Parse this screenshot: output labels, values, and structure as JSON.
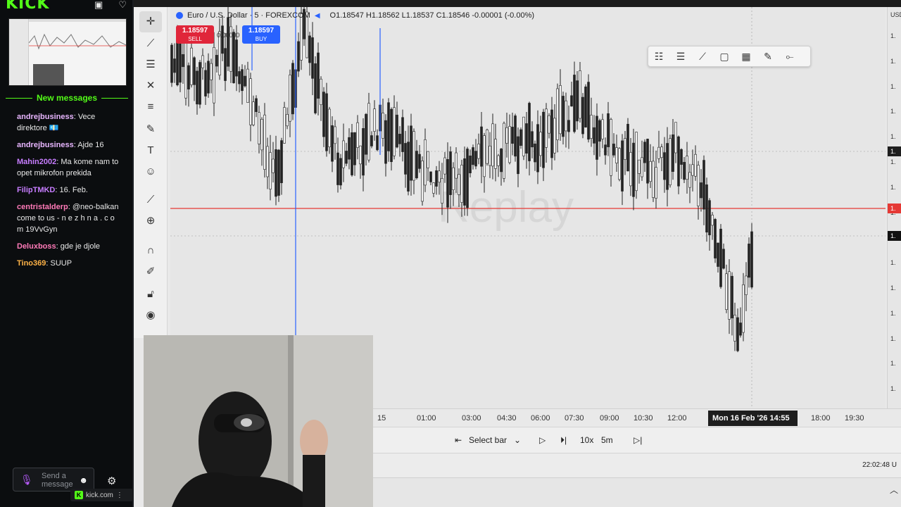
{
  "kick": {
    "logo": "KICK",
    "new_messages_label": "New messages",
    "chat": [
      {
        "user": "andrejbusiness",
        "color": "#e8b6ff",
        "text": "Vece direktore 💶"
      },
      {
        "user": "andrejbusiness",
        "color": "#e8b6ff",
        "text": "Ajde 16"
      },
      {
        "user": "Mahin2002",
        "color": "#c77dff",
        "text": "Ma kome nam to opet mikrofon prekida"
      },
      {
        "user": "FilipTMKD",
        "color": "#c77dff",
        "text": "16. Feb."
      },
      {
        "user": "centristalderp",
        "color": "#ff7ab8",
        "text": "@neo-balkan come to us - n e z h n a . c o m 19VvGyn"
      },
      {
        "user": "Deluxboss",
        "color": "#ff7ab8",
        "text": "gde je djole"
      },
      {
        "user": "Tino369",
        "color": "#ffb347",
        "text": "SUUP"
      }
    ],
    "input_placeholder": "Send a message",
    "footer_domain": "kick.com",
    "footer_logo": "K"
  },
  "chart": {
    "symbol": "Euro / U.S. Dollar · 5 · FOREXCOM",
    "ohlc": "O1.18547 H1.18562 L1.18537 C1.18546 -0.00001 (-0.00%)",
    "sell_price": "1.18597",
    "sell_label": "SELL",
    "buy_price": "1.18597",
    "buy_label": "BUY",
    "spread": "0.00000",
    "watermark": "Replay",
    "price_scale_currency": "USD",
    "price_labels": [
      "1.",
      "1.",
      "1.",
      "1.",
      "1.",
      "1.",
      "1.",
      "1.",
      "1.",
      "1.",
      "1.",
      "1.",
      "1.",
      "1.",
      "1.",
      "1."
    ],
    "price_marker_cursor": "1.",
    "price_marker_red": "1.",
    "price_marker_last": "1.",
    "time_labels": [
      "15",
      "01:00",
      "03:00",
      "04:30",
      "06:00",
      "07:30",
      "09:00",
      "10:30",
      "12:00",
      "18:00",
      "19:30"
    ],
    "cursor_time": "Mon 16 Feb '26   14:55",
    "colors": {
      "red_line": "#e53935",
      "buy": "#2962ff",
      "sell": "#e0263a"
    }
  },
  "replay": {
    "select_bar": "Select bar",
    "speed": "10x",
    "interval": "5m"
  },
  "clock": "22:02:48 U"
}
